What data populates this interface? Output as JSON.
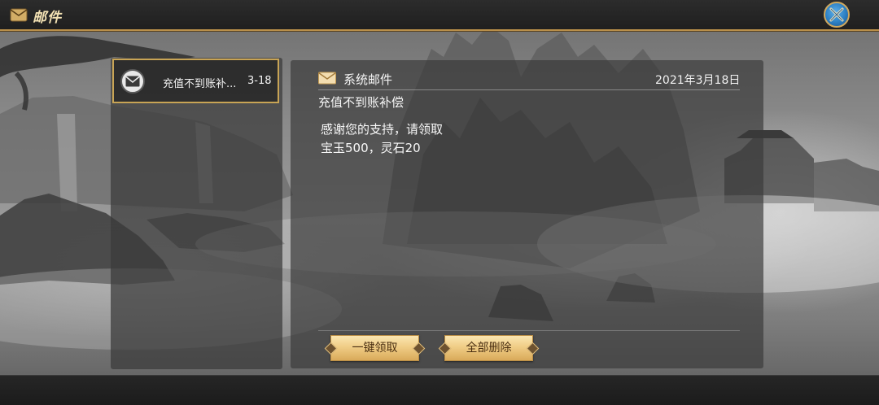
{
  "header": {
    "title": "邮件",
    "icon": "mail-icon",
    "close_icon": "close-icon"
  },
  "mail_list": [
    {
      "subject": "充值不到账补...",
      "date": "3-18",
      "icon": "envelope-icon",
      "selected": true
    }
  ],
  "mail_detail": {
    "sender": "系统邮件",
    "date": "2021年3月18日",
    "subject": "充值不到账补偿",
    "body_lines": [
      "感谢您的支持，请领取",
      "宝玉500，灵石20"
    ]
  },
  "actions": {
    "claim_all": "一键领取",
    "delete_all": "全部删除"
  },
  "colors": {
    "accent_gold": "#c8a455",
    "button_text": "#4a2f12"
  }
}
